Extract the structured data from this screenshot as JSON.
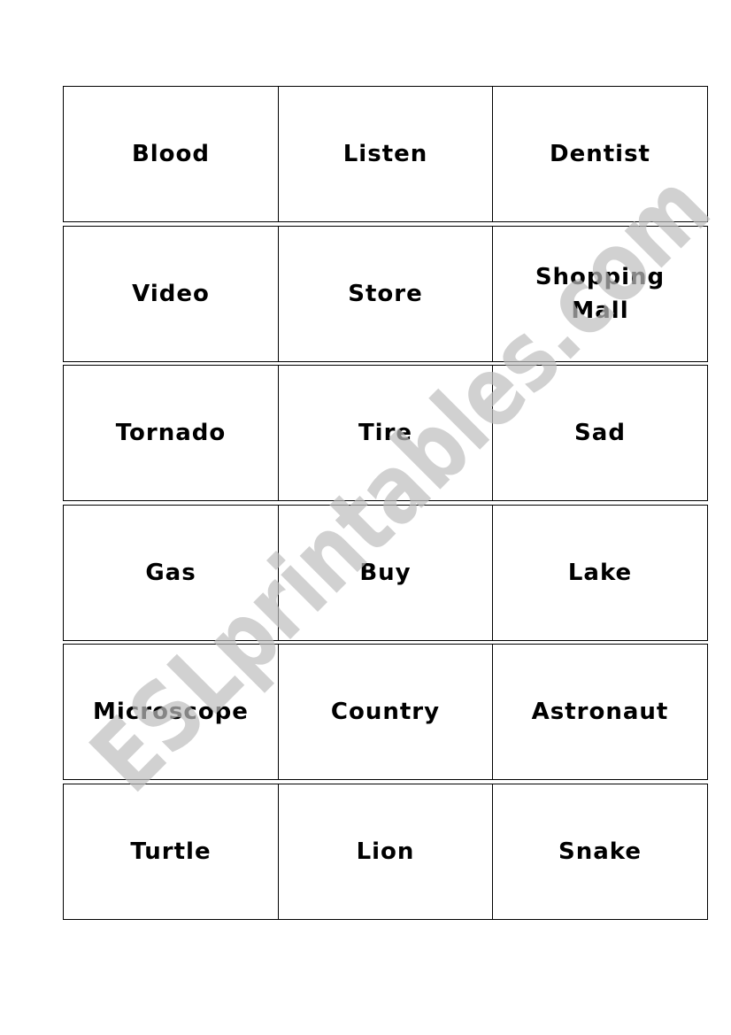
{
  "document": {
    "rows": [
      [
        "Blood",
        "Listen",
        "Dentist"
      ],
      [
        "Video",
        "Store",
        "Shopping\nMall"
      ],
      [
        "Tornado",
        "Tire",
        "Sad"
      ],
      [
        "Gas",
        "Buy",
        "Lake"
      ],
      [
        "Microscope",
        "Country",
        "Astronaut"
      ],
      [
        "Turtle",
        "Lion",
        "Snake"
      ]
    ]
  },
  "watermark": {
    "text": "ESLprintables.com",
    "color": "#cccccc"
  }
}
